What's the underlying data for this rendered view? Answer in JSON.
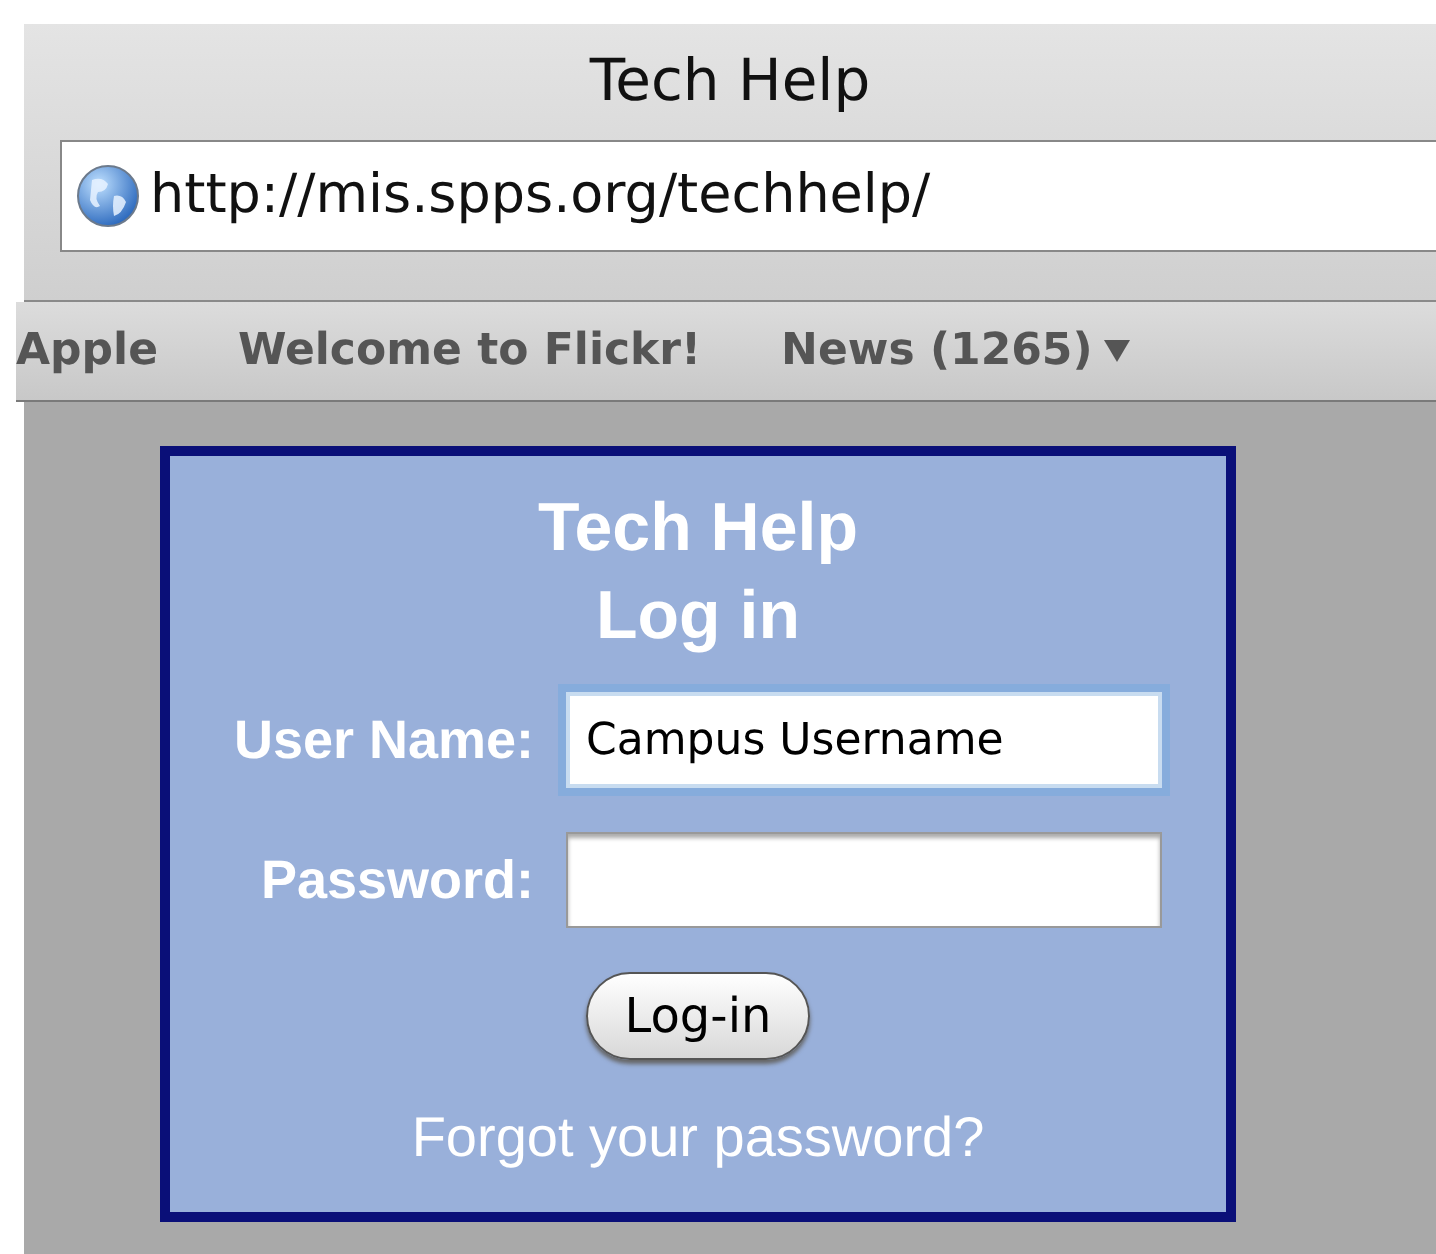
{
  "window": {
    "title": "Tech Help"
  },
  "address_bar": {
    "url": "http://mis.spps.org/techhelp/"
  },
  "bookmarks": [
    {
      "label": "Apple",
      "menu": false
    },
    {
      "label": "Welcome to Flickr!",
      "menu": false
    },
    {
      "label": "News (1265)",
      "menu": true
    }
  ],
  "login_panel": {
    "title": "Tech Help",
    "subtitle": "Log in",
    "fields": [
      {
        "label": "User Name:",
        "value": "Campus Username",
        "focused": true
      },
      {
        "label": "Password:",
        "focused": false
      }
    ],
    "button": "Log-in",
    "link": "Forgot your password?"
  }
}
